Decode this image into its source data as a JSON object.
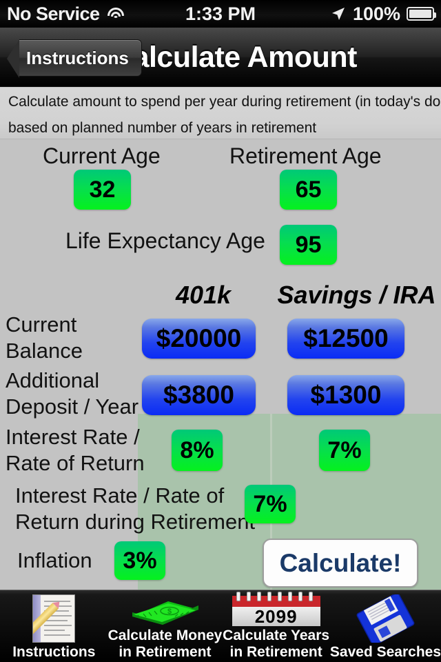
{
  "status_bar": {
    "carrier": "No Service",
    "wifi_icon": "wifi-icon",
    "time": "1:33 PM",
    "location_icon": "location-arrow-icon",
    "battery_percent": "100%",
    "battery_icon": "battery-full-icon"
  },
  "nav_bar": {
    "back_label": "Instructions",
    "title": "Calculate Amount"
  },
  "description": {
    "line1": "Calculate amount to spend per year during retirement (in today's dollars)",
    "line2": "based on planned number of years in retirement"
  },
  "form": {
    "current_age": {
      "label": "Current Age",
      "value": "32"
    },
    "retirement_age": {
      "label": "Retirement Age",
      "value": "65"
    },
    "life_expectancy_age": {
      "label": "Life Expectancy Age",
      "value": "95"
    },
    "columns": [
      "401k",
      "Savings / IRA"
    ],
    "rows": [
      {
        "label_line1": "Current",
        "label_line2": "Balance",
        "col_401k": "$20000",
        "col_savings": "$12500",
        "kind": "money"
      },
      {
        "label_line1": "Additional",
        "label_line2": "Deposit / Year",
        "col_401k": "$3800",
        "col_savings": "$1300",
        "kind": "money"
      },
      {
        "label_line1": "Interest Rate /",
        "label_line2": "Rate of Return",
        "col_401k": "8%",
        "col_savings": "7%",
        "kind": "rate"
      }
    ],
    "retirement_rate": {
      "label_line1": "Interest Rate / Rate of",
      "label_line2": "Return during Retirement",
      "value": "7%"
    },
    "inflation": {
      "label": "Inflation",
      "value": "3%"
    },
    "calculate_button": "Calculate!"
  },
  "tab_bar": {
    "tabs": [
      {
        "icon": "document-pencil-icon",
        "label_line1": "Instructions",
        "label_line2": ""
      },
      {
        "icon": "money-stack-icon",
        "label_line1": "Calculate Money",
        "label_line2": "in Retirement"
      },
      {
        "icon": "calendar-icon",
        "label_line1": "Calculate Years",
        "label_line2": "in Retirement",
        "calendar_year": "2099"
      },
      {
        "icon": "floppy-disk-icon",
        "label_line1": "Saved Searches",
        "label_line2": ""
      }
    ]
  },
  "colors": {
    "field_green_top": "#00c878",
    "field_green_bottom": "#05f11e",
    "field_blue_top": "#89a8ea",
    "field_blue_bottom": "#0a2bf5",
    "panel_sage": "#a9c3ab",
    "page_background": "#c3c3c3",
    "calculate_text": "#1b3a68"
  }
}
